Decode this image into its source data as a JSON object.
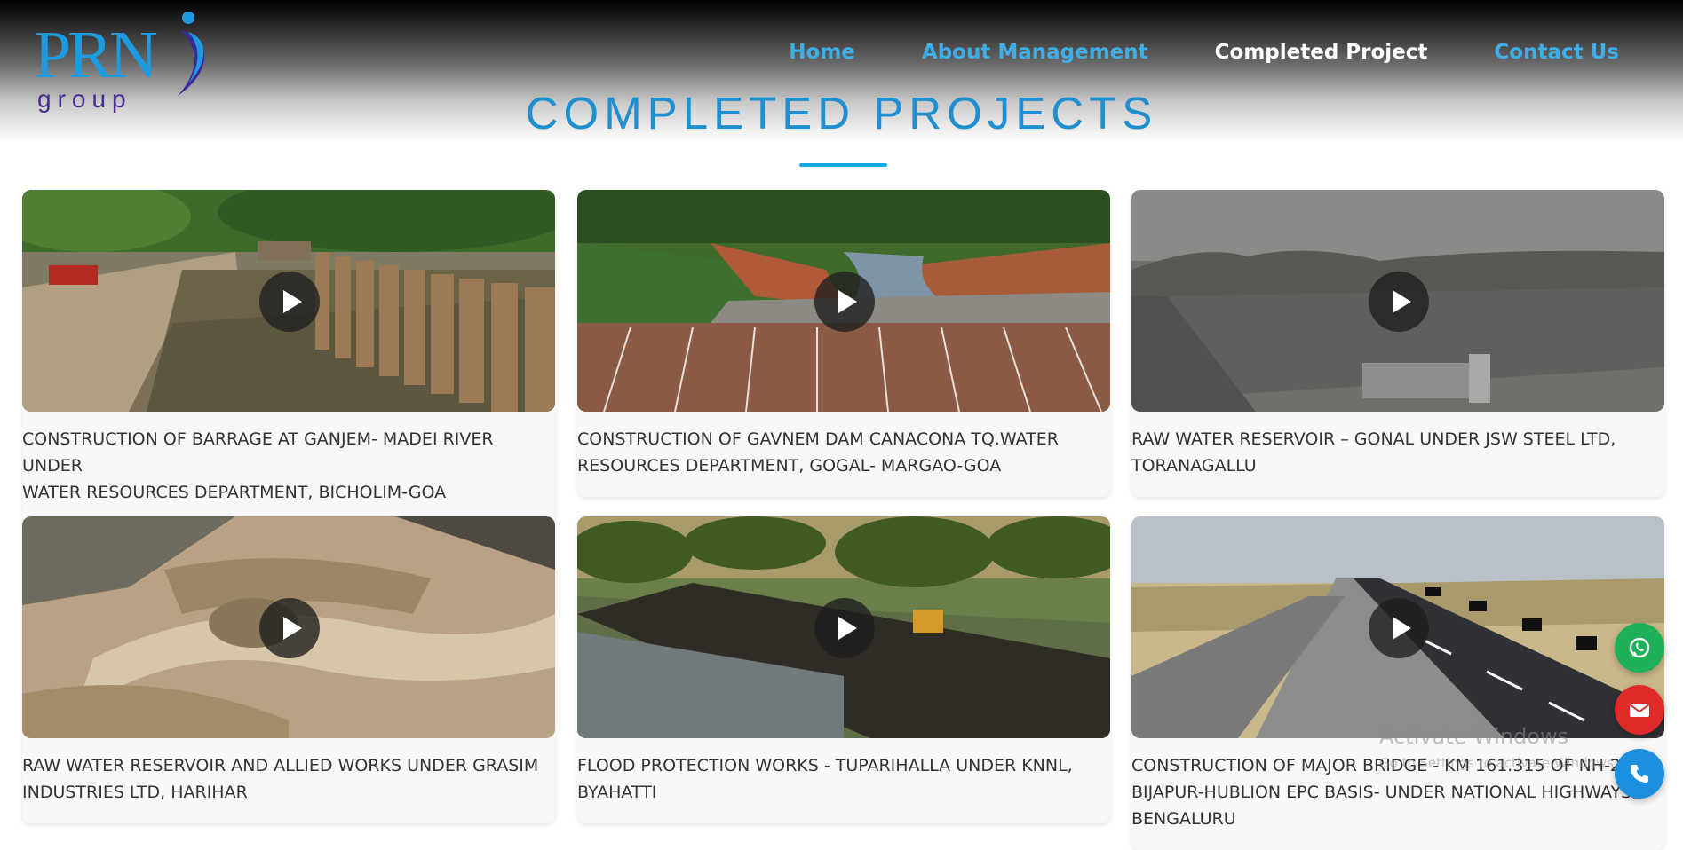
{
  "brand": {
    "logo_main": "PRN",
    "logo_sub": "group",
    "colors": {
      "primary": "#1e9be0",
      "secondary": "#4a2a90"
    }
  },
  "nav": {
    "items": [
      {
        "label": "Home",
        "active": false
      },
      {
        "label": "About Management",
        "active": false
      },
      {
        "label": "Completed Project",
        "active": true
      },
      {
        "label": "Contact Us",
        "active": false
      }
    ],
    "link_color": "#3eaee6",
    "active_color": "#ffffff"
  },
  "page": {
    "heading": "COMPLETED PROJECTS",
    "heading_color": "#1f8fd0"
  },
  "projects": [
    {
      "caption_lines": [
        "CONSTRUCTION OF BARRAGE AT GANJEM- MADEI RIVER UNDER",
        "WATER RESOURCES DEPARTMENT, BICHOLIM-GOA"
      ],
      "scene": "barrage-construction"
    },
    {
      "caption_lines": [
        "CONSTRUCTION OF GAVNEM DAM CANACONA TQ.WATER",
        "RESOURCES DEPARTMENT, GOGAL- MARGAO-GOA"
      ],
      "scene": "dam-river-valley"
    },
    {
      "caption_lines": [
        "RAW WATER RESERVOIR – GONAL UNDER JSW STEEL LTD,",
        "TORANAGALLU"
      ],
      "scene": "hazy-reservoir"
    },
    {
      "caption_lines": [
        "RAW WATER RESERVOIR AND ALLIED WORKS UNDER GRASIM",
        "INDUSTRIES LTD, HARIHAR"
      ],
      "scene": "earthworks-site"
    },
    {
      "caption_lines": [
        "FLOOD PROTECTION WORKS - TUPARIHALLA UNDER KNNL,",
        "BYAHATTI"
      ],
      "scene": "river-embankment"
    },
    {
      "caption_lines": [
        "CONSTRUCTION OF MAJOR BRIDGE - KM 161.315 OF NH-218",
        "BIJAPUR-HUBLION EPC BASIS- UNDER NATIONAL HIGHWAYS,",
        "BENGALURU"
      ],
      "scene": "highway-bridge"
    }
  ],
  "overlay": {
    "watermark_title": "Activate Windows",
    "watermark_sub": "Go to Settings to activate Windows."
  },
  "floating_actions": [
    {
      "name": "whatsapp",
      "icon": "whatsapp-icon",
      "color": "#1fb15a"
    },
    {
      "name": "mail",
      "icon": "envelope-icon",
      "color": "#e02a2a"
    },
    {
      "name": "phone",
      "icon": "phone-icon",
      "color": "#1c8fde"
    }
  ]
}
